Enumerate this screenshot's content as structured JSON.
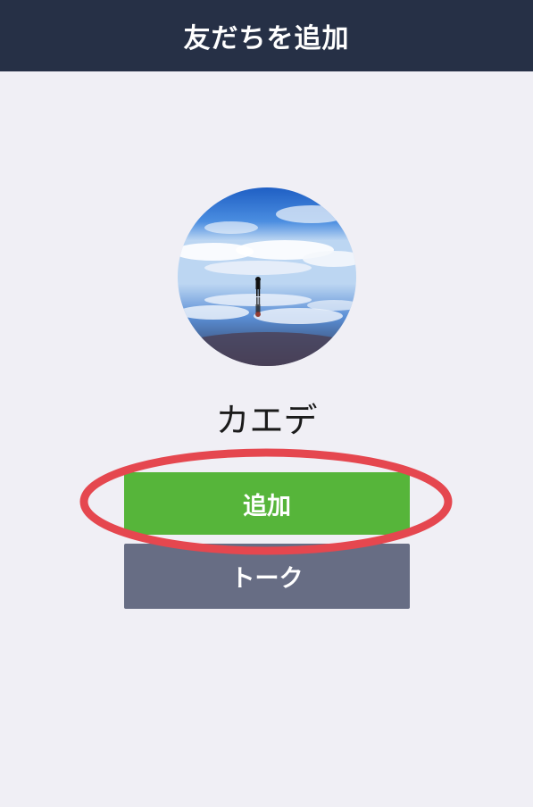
{
  "header": {
    "title": "友だちを追加"
  },
  "profile": {
    "name": "カエデ",
    "avatar_icon": "landscape-photo-avatar"
  },
  "actions": {
    "add_label": "追加",
    "talk_label": "トーク"
  },
  "colors": {
    "header_bg": "#263046",
    "page_bg": "#f0eff5",
    "add_button": "#56b53a",
    "talk_button": "#676d84",
    "highlight_ring": "#e5474f"
  }
}
